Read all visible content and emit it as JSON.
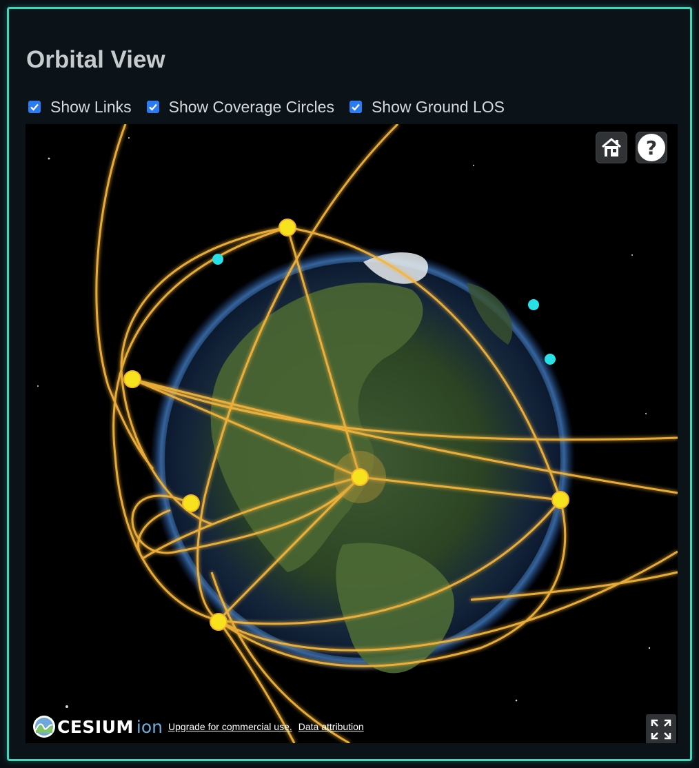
{
  "panel": {
    "title": "Orbital View"
  },
  "toggles": [
    {
      "label": "Show Links",
      "checked": true
    },
    {
      "label": "Show Coverage Circles",
      "checked": true
    },
    {
      "label": "Show Ground LOS",
      "checked": true
    }
  ],
  "viewer": {
    "home_icon": "home-icon",
    "help_label": "?",
    "fullscreen_icon": "fullscreen-icon",
    "credits": {
      "brand": "CESIUM",
      "brand_suffix": "ion",
      "upgrade_link": "Upgrade for commercial use.",
      "attribution_link": "Data attribution"
    },
    "colors": {
      "orbit": "#f5b53a",
      "satellite": "#f7e21e",
      "ground_station": "#28e0e6",
      "accent_border": "#3fd8bd"
    }
  }
}
